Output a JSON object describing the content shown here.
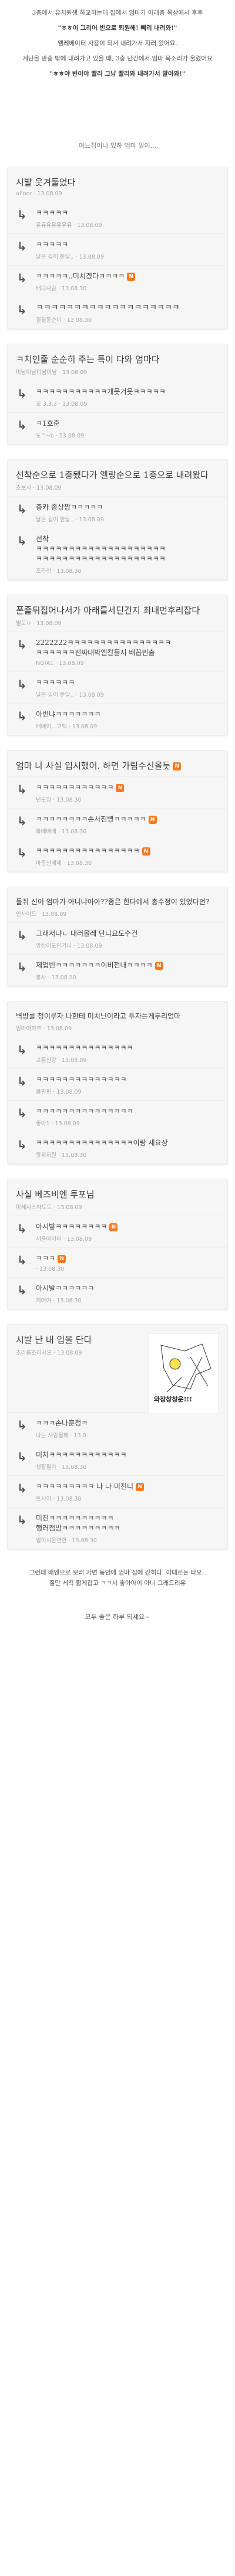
{
  "intro": {
    "lines": [
      "3층에서 유치원생 하교하는데 집에서 엄마가 아래층 옥상에서 후후",
      "\"ㅎㅎ이 그리어 빈으로 퇴원해! 빼리 내려와!\"",
      "엘레베이터 사용이 되서 내려가서 자러 왔어요.",
      "계단을 반층 밖에 내려가고 있을 때, 3층 난간에서 엄마 목소리가 울렸어요",
      "\"ㅎㅎ야 빈이야 빨리 그냥 빨리와 내려가서 말아와!\""
    ],
    "subtitle": "어느집이나 있하 엄마 일이..."
  },
  "cards": [
    {
      "title": "시발 웃겨둘었다",
      "author": "afloor",
      "date": "13.08.09",
      "replies": [
        {
          "text": "ㅋㅋㅋㅋㅋ",
          "author": "유유유유유유유",
          "date": "13.08.09",
          "lv": 1
        },
        {
          "text": "ㅋㅋㅋㅋㅋ",
          "author": "날은 길이 한달..",
          "date": "13.08.09",
          "lv": 1
        },
        {
          "text": "ㅋㅋㅋㅋㅋ..미치겠다ㅋㅋㅋㅋ",
          "author": "배디사람",
          "date": "13.08.30",
          "lv": 1,
          "n": true
        },
        {
          "text": "ㅋㅋㅋㅋㅋㅋㅋㅋㅋㅋㅋㅋㅋㅋㅋㅋㅋㅋㅋ",
          "author": "결필동순이",
          "date": "13.08.30",
          "lv": 1,
          "big": true
        }
      ]
    },
    {
      "title": "ㅋ치인줄 순순히 주는 특이 다와 엄마다",
      "author": "미남미남미남미남",
      "date": "13.08.09",
      "replies": [
        {
          "text": "ㅋㅋㅋㅋㅋㅋㅋㅋㅋㅋㅋ개웃겨웃ㅋㅋㅋㅋㅋ",
          "author": "꼬 3.3.3",
          "date": "13.08.09",
          "lv": 1
        },
        {
          "text": "ㅋ1호준",
          "author": "도^~b",
          "date": "13.08.09",
          "lv": 1
        }
      ]
    },
    {
      "title": "선착순으로 1층됐다가 엘랑순으로 1층으로 내려왔다",
      "author": "초보사",
      "date": "13.08.09",
      "replies": [
        {
          "text": "총카 종상짱ㅋㅋㅋㅋㅋ",
          "author": "날은 길이 한달..",
          "date": "13.08.09",
          "lv": 1
        },
        {
          "text": "선착\nㅋㅋㅋㅋㅋㅋㅋㅋㅋㅋㅋㅋㅋㅋㅋㅋㅋㅋㅋㅋ\nㅋㅋㅋㅋㅋㅋㅋㅋㅋㅋㅋㅋㅋㅋㅋㅋㅋㅋㅋㅋ",
          "author": "포라쉬",
          "date": "13.08.30",
          "lv": 1
        }
      ]
    },
    {
      "title": "폰줄뒤집어나서가 아래를세딘건지 최내먼후리잡다",
      "author": "벌도ㅇ",
      "date": "13.08.09",
      "replies": [
        {
          "text": "2222222ㅋㅋㅋㅋㅋㅋㅋㅋㅋㅋㅋㅋㅋㅋㅋㅋ\nㅋㅋㅋㅋㅋㅋ진짜대박엘칼들지 배꼽빈출",
          "author": "NO/A1",
          "date": "13.08.09",
          "lv": 1
        },
        {
          "text": "ㅋㅋㅋㅋㅋㅋ",
          "author": "날은 길이 한달..",
          "date": "13.08.09",
          "lv": 1
        },
        {
          "text": "아빈냐ㅋㅋㅋㅋㅋㅋㅋ",
          "author": "배배이.. 고백",
          "date": "13.08.09",
          "lv": 1
        }
      ]
    },
    {
      "title": "엄마 나 사실 입시했어. 하면 가림수신올듯",
      "author": "",
      "date": "",
      "titleBadge": true,
      "replies": [
        {
          "text": "ㅋㅋㅋㅋㅋㅋㅋㅋㅋㅋㅋㅋ",
          "author": "넌도임",
          "date": "13.08.30",
          "lv": 1,
          "n": true
        },
        {
          "text": "ㅋㅋㅋㅋㅋㅋㅋㅋ손사진빵ㅋㅋㅋㅋㅋ",
          "author": "화배배배",
          "date": "13.08.30",
          "lv": 1,
          "n": true
        },
        {
          "text": "ㅋㅋㅋㅋㅋㅋㅋㅋㅋㅋㅋㅋㅋㅋㅋㅋ",
          "author": "마음산배체",
          "date": "13.08.30",
          "lv": 1,
          "n": true
        }
      ]
    },
    {
      "title": "들쥐 신이 엄마가 아니냐아아??종은 한다에서 총수정이 있었다던?",
      "author": "인사이드",
      "date": "13.08.09",
      "small": true,
      "replies": [
        {
          "text": "그래서냐ㄴ 내러올레 단니요도수건",
          "author": "앞산이도인가니",
          "date": "13.08.09",
          "lv": 1
        },
        {
          "text": "제업빈ㅋㅋㅋㅋㅋㅋㅋ이비전내ㅋㅋㅋㅋ",
          "author": "봉사",
          "date": "13.08.10",
          "lv": 1,
          "n": true
        }
      ]
    },
    {
      "title": "벽방를 청이루자 나한테 미치닌이라고 투자는게두리엄마",
      "author": "엄마아하흐",
      "date": "13.08.09",
      "small": true,
      "replies": [
        {
          "text": "ㅋㅋㅋㅋㅋㅋㅋㅋㅋㅋㅋㅋㅋㅋㅋ",
          "author": "고흥신앙",
          "date": "13.08.09",
          "lv": 1
        },
        {
          "text": "ㅋㅋㅋㅋㅋㅋㅋㅋㅋㅋㅋㅋㅋㅋ",
          "author": "볼핀핀",
          "date": "13.08.09",
          "lv": 1
        },
        {
          "text": "ㅋㅋㅋㅋㅋㅋㅋㅋㅋㅋㅋㅋㅋㅋㅋ",
          "author": "좋아1",
          "date": "13.08.09",
          "lv": 1
        },
        {
          "text": "ㅋㅋㅋㅋㅋㅋㅋㅋㅋㅋㅋㅋㅋㅋㅋ이랑 세요상",
          "author": "왓위위원",
          "date": "13.08.30",
          "lv": 1
        }
      ]
    },
    {
      "title": "사실 베즈비엔 투포님",
      "author": "미세사스파도도",
      "date": "13.08.09",
      "replies": [
        {
          "text": "아시밯ㅋㅋㅋㅋㅋㅋㅋㅋ",
          "author": "세윤아이어",
          "date": "13.08.09",
          "lv": 1,
          "n": true
        },
        {
          "text": "ㅋㅋㅋ",
          "author": "",
          "date": "13.08.30",
          "lv": 1,
          "n": true
        },
        {
          "text": "아시발ㅋㅋㅋㅋㅋㅋ",
          "author": "저어여",
          "date": "13.08.30",
          "lv": 1
        }
      ]
    },
    {
      "title": "시발 난 내 입을 단다",
      "author": "초라를조이시오",
      "date": "13.08.09",
      "doodleText": "와장창창운!!!",
      "replies": [
        {
          "text": "ㅋㅋㅋ손나훈정ㅋ",
          "author": "나는 사람필해",
          "date": "13.0",
          "lv": 1
        },
        {
          "text": "미치ㅋㅋㅋㅋㅋㅋㅋㅋㅋㅋㅋㅋ",
          "author": "생활필가",
          "date": "13.08.30",
          "lv": 1
        },
        {
          "text": "ㅋㅋㅋㅋㅋㅋㅋㅋㅋ 나 나 미친니",
          "author": "트시이",
          "date": "13.08.30",
          "lv": 1,
          "n": true
        },
        {
          "text": "미친ㅋㅋㅋㅋㅋㅋㅋㅋㅋㅋ\n행러점방ㅋㅋㅋㅋㅋㅋㅋㅋㅋ",
          "author": "일이시은연한",
          "date": "13.08.30",
          "lv": 1
        }
      ]
    }
  ],
  "outro": {
    "lines": [
      "그런데 배엔으로 보러 가면 동안에 엄마 집에 갇히다. 이대로는 타오..",
      "질만 세칙 짧게잡고 ㅋㅋ시 좋아아이 아니 그래드리유"
    ],
    "closing": "모두 좋은 하루 되세요~"
  }
}
